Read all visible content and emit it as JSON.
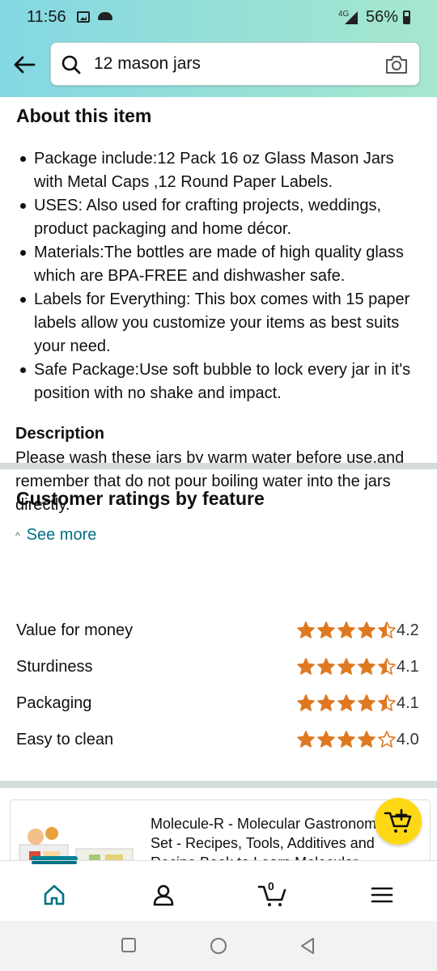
{
  "status_bar": {
    "time": "11:56",
    "network": "4G",
    "battery": "56%"
  },
  "search": {
    "query": "12 mason jars"
  },
  "about": {
    "title": "About this item",
    "bullets": [
      "Package include:12 Pack 16 oz Glass Mason Jars with Metal Caps ,12 Round Paper Labels.",
      "USES: Also used for crafting projects, weddings, product packaging and home décor.",
      "Materials:The bottles are made of high quality glass which are BPA-FREE and dishwasher safe.",
      "Labels for Everything: This box comes with 15 paper labels allow you customize your items as best suits your need.",
      "Safe Package:Use soft bubble to lock every jar in it's position with no shake and impact."
    ]
  },
  "description": {
    "title": "Description",
    "text": "Please wash these jars by warm water before use,and remember that do not pour boiling water into the jars directly.",
    "see_more": "See more"
  },
  "ratings": {
    "title": "Customer ratings by feature",
    "star_color": "#de7921",
    "items": [
      {
        "label": "Value for money",
        "value": "4.2",
        "stars": 4.5
      },
      {
        "label": "Sturdiness",
        "value": "4.1",
        "stars": 4.5
      },
      {
        "label": "Packaging",
        "value": "4.1",
        "stars": 4.5
      },
      {
        "label": "Easy to clean",
        "value": "4.0",
        "stars": 4.0
      }
    ]
  },
  "product_card": {
    "title": "Molecule-R - Molecular Gastronomy Set - Recipes, Tools, Additives and Recipe Book to Learn Molecular"
  },
  "bottom_nav": {
    "cart_count": "0",
    "items": [
      "home-icon",
      "account-icon",
      "cart-icon",
      "menu-icon"
    ]
  },
  "colors": {
    "accent": "#007185",
    "header_gradient_start": "#84d8e3",
    "header_gradient_end": "#a6e7ce",
    "add_to_cart": "#ffd814"
  }
}
